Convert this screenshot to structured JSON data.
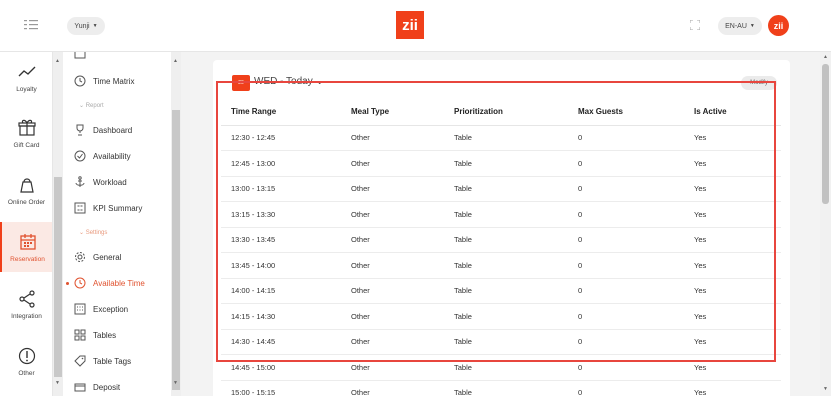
{
  "topbar": {
    "user": "Yunji",
    "logo": "zii",
    "language": "EN-AU",
    "avatar": "zii"
  },
  "rail": [
    {
      "label": "Loyalty",
      "icon": "chart-line-icon"
    },
    {
      "label": "Gift Card",
      "icon": "gift-icon"
    },
    {
      "label": "Online Order",
      "icon": "bag-icon"
    },
    {
      "label": "Reservation",
      "icon": "calendar-icon",
      "active": true
    },
    {
      "label": "Integration",
      "icon": "share-icon"
    },
    {
      "label": "Other",
      "icon": "info-icon"
    }
  ],
  "submenu": {
    "top_item": "Time Matrix",
    "report_section": "Report",
    "report_items": [
      "Dashboard",
      "Availability",
      "Workload",
      "KPI Summary"
    ],
    "settings_section": "Settings",
    "settings_items": [
      "General",
      "Available Time",
      "Exception",
      "Tables",
      "Table Tags",
      "Deposit"
    ],
    "active": "Available Time"
  },
  "card": {
    "date_badge": "20",
    "date_title": "WED - Today",
    "modify": "Modify"
  },
  "table": {
    "headers": [
      "Time Range",
      "Meal Type",
      "Prioritization",
      "Max Guests",
      "Is Active"
    ],
    "rows": [
      [
        "12:30 - 12:45",
        "Other",
        "Table",
        "0",
        "Yes"
      ],
      [
        "12:45 - 13:00",
        "Other",
        "Table",
        "0",
        "Yes"
      ],
      [
        "13:00 - 13:15",
        "Other",
        "Table",
        "0",
        "Yes"
      ],
      [
        "13:15 - 13:30",
        "Other",
        "Table",
        "0",
        "Yes"
      ],
      [
        "13:30 - 13:45",
        "Other",
        "Table",
        "0",
        "Yes"
      ],
      [
        "13:45 - 14:00",
        "Other",
        "Table",
        "0",
        "Yes"
      ],
      [
        "14:00 - 14:15",
        "Other",
        "Table",
        "0",
        "Yes"
      ],
      [
        "14:15 - 14:30",
        "Other",
        "Table",
        "0",
        "Yes"
      ],
      [
        "14:30 - 14:45",
        "Other",
        "Table",
        "0",
        "Yes"
      ],
      [
        "14:45 - 15:00",
        "Other",
        "Table",
        "0",
        "Yes"
      ],
      [
        "15:00 - 15:15",
        "Other",
        "Table",
        "0",
        "Yes"
      ]
    ]
  },
  "colors": {
    "accent": "#f0401a",
    "highlight": "#e8463e"
  }
}
